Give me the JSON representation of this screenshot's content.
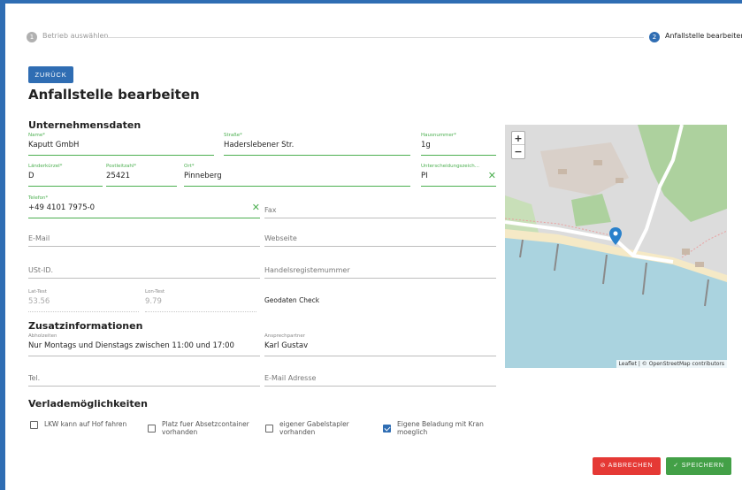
{
  "stepper": {
    "step1": {
      "number": "1",
      "label": "Betrieb auswählen"
    },
    "step2": {
      "number": "2",
      "label": "Anfallstelle bearbeiten"
    }
  },
  "back_button": "ZURÜCK",
  "page_title": "Anfallstelle bearbeiten",
  "sections": {
    "company": "Unternehmensdaten",
    "additional": "Zusatzinformationen",
    "loading": "Verlademöglichkeiten"
  },
  "fields": {
    "name": {
      "label": "Name*",
      "value": "Kaputt GmbH"
    },
    "street": {
      "label": "Straße*",
      "value": "Haderslebener Str."
    },
    "house_number": {
      "label": "Hausnummer*",
      "value": "1g"
    },
    "country_code": {
      "label": "Länderkürzel*",
      "value": "D"
    },
    "postal_code": {
      "label": "Postleitzahl*",
      "value": "25421"
    },
    "city": {
      "label": "Ort*",
      "value": "Pinneberg"
    },
    "distinguishing_mark": {
      "label": "Unterscheidungszeich...",
      "value": "PI"
    },
    "phone": {
      "label": "Telefon*",
      "value": "+49 4101 7975-0"
    },
    "fax": {
      "placeholder": "Fax"
    },
    "email": {
      "placeholder": "E-Mail"
    },
    "website": {
      "placeholder": "Webseite"
    },
    "vat_id": {
      "placeholder": "USt-ID."
    },
    "trade_register": {
      "placeholder": "Handelsregistemummer"
    },
    "lat_test": {
      "label": "Lat-Test",
      "value": "53.56"
    },
    "lon_test": {
      "label": "Lon-Test",
      "value": "9.79"
    },
    "geodata_check": "Geodaten Check",
    "pickup_times": {
      "label": "Abholzeiten",
      "value": "Nur Montags und Dienstags zwischen 11:00 und 17:00"
    },
    "contact_person": {
      "label": "Ansprechpartner",
      "value": "Karl Gustav"
    },
    "tel": {
      "placeholder": "Tel."
    },
    "email_address": {
      "placeholder": "E-Mail Adresse"
    }
  },
  "checkboxes": [
    {
      "label": "LKW kann auf Hof fahren",
      "checked": false
    },
    {
      "label": "Platz fuer Absetzcontainer vorhanden",
      "checked": false
    },
    {
      "label": "eigener Gabelstapler vorhanden",
      "checked": false
    },
    {
      "label": "Eigene Beladung mit Kran moeglich",
      "checked": true
    }
  ],
  "map": {
    "zoom_in": "+",
    "zoom_out": "−",
    "attribution": "Leaflet | © OpenStreetMap contributors",
    "colors": {
      "water": "#aad3df",
      "land": "#dcdcdc",
      "forest": "#add19e",
      "beach": "#f5e9c6",
      "road": "#ffffff",
      "marker": "#2a81cb"
    }
  },
  "actions": {
    "cancel": "ABBRECHEN",
    "save": "SPEICHERN",
    "cancel_color": "#e53935",
    "save_color": "#43a047"
  }
}
